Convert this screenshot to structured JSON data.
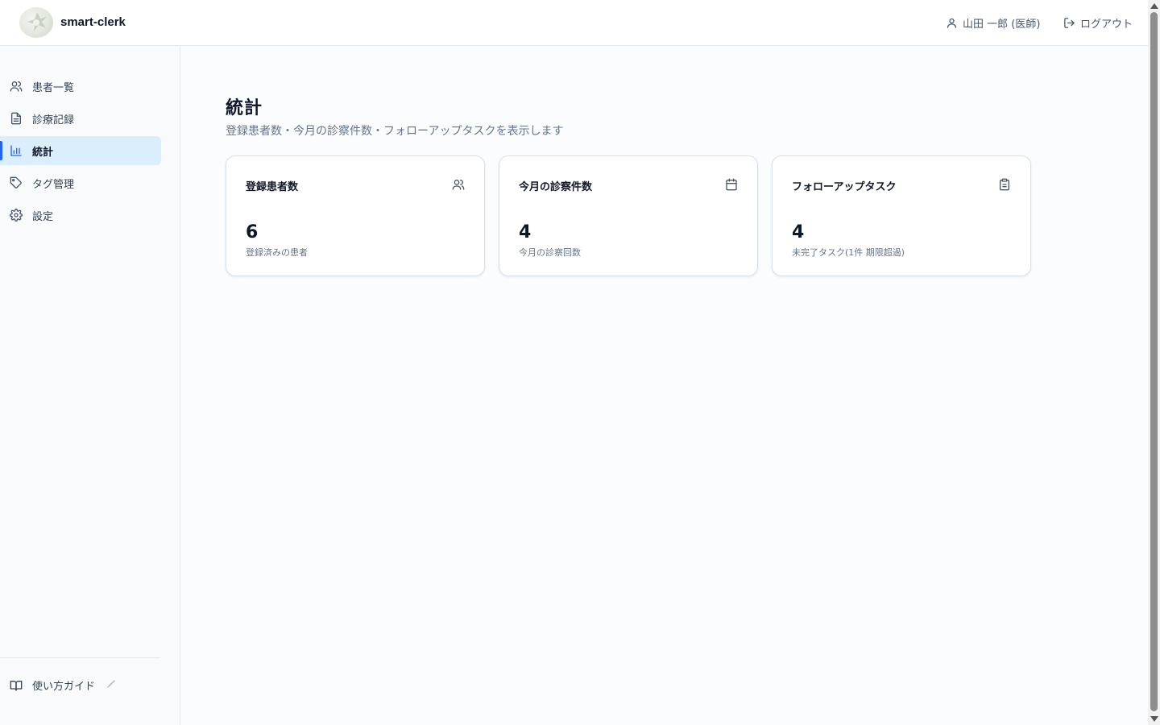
{
  "header": {
    "app_name": "smart-clerk",
    "user_label": "山田 一郎 (医師)",
    "logout_label": "ログアウト"
  },
  "sidebar": {
    "items": [
      {
        "label": "患者一覧",
        "icon": "users-icon",
        "active": false
      },
      {
        "label": "診療記録",
        "icon": "file-text-icon",
        "active": false
      },
      {
        "label": "統計",
        "icon": "bar-chart-icon",
        "active": true
      },
      {
        "label": "タグ管理",
        "icon": "tag-icon",
        "active": false
      },
      {
        "label": "設定",
        "icon": "gear-icon",
        "active": false
      }
    ],
    "guide_label": "使い方ガイド"
  },
  "main": {
    "title": "統計",
    "subtitle": "登録患者数・今月の診察件数・フォローアップタスクを表示します",
    "cards": [
      {
        "title": "登録患者数",
        "icon": "users-icon",
        "value": "6",
        "desc": "登録済みの患者"
      },
      {
        "title": "今月の診察件数",
        "icon": "calendar-icon",
        "value": "4",
        "desc": "今月の診察回数"
      },
      {
        "title": "フォローアップタスク",
        "icon": "clipboard-icon",
        "value": "4",
        "desc": "未完了タスク(1件 期限超過)"
      }
    ]
  },
  "colors": {
    "accent": "#2563eb",
    "active_bg": "#dbeefc"
  }
}
